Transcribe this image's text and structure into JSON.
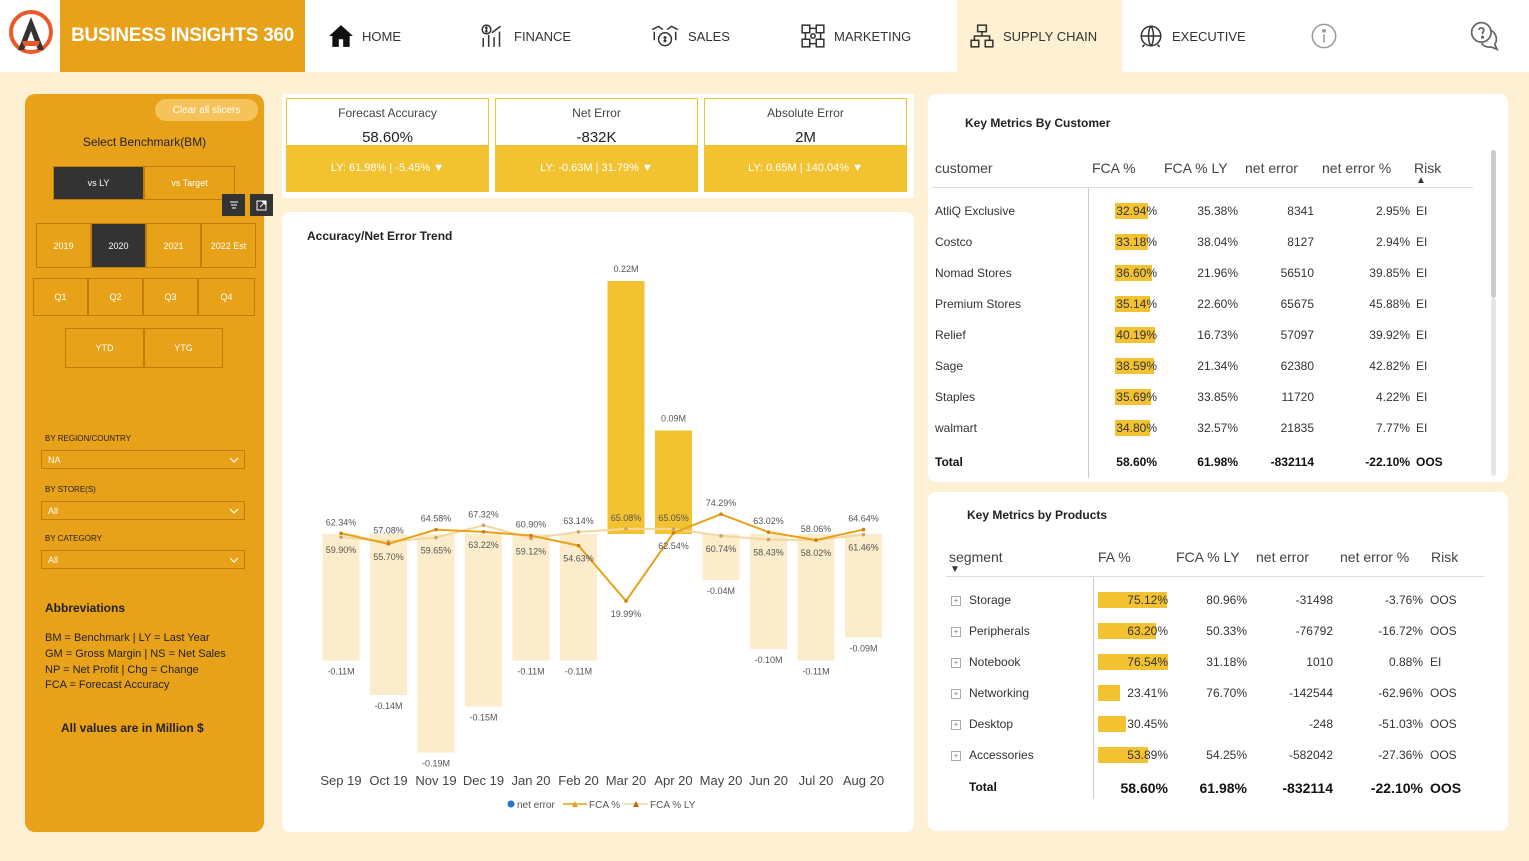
{
  "brand": {
    "title": "BUSINESS INSIGHTS 360"
  },
  "nav": [
    {
      "label": "HOME",
      "icon": "home-icon"
    },
    {
      "label": "FINANCE",
      "icon": "finance-icon"
    },
    {
      "label": "SALES",
      "icon": "sales-icon"
    },
    {
      "label": "MARKETING",
      "icon": "marketing-icon"
    },
    {
      "label": "SUPPLY CHAIN",
      "icon": "supply-chain-icon",
      "active": true
    },
    {
      "label": "EXECUTIVE",
      "icon": "executive-icon"
    }
  ],
  "sidebar": {
    "clear_label": "Clear all slicers",
    "benchmark_title": "Select Benchmark(BM)",
    "benchmark": [
      {
        "label": "vs LY",
        "selected": true
      },
      {
        "label": "vs Target",
        "selected": false
      }
    ],
    "years": [
      {
        "label": "2019"
      },
      {
        "label": "2020",
        "selected": true
      },
      {
        "label": "2021"
      },
      {
        "label": "2022 Est"
      }
    ],
    "quarters": [
      {
        "label": "Q1"
      },
      {
        "label": "Q2"
      },
      {
        "label": "Q3"
      },
      {
        "label": "Q4"
      }
    ],
    "periods": [
      {
        "label": "YTD"
      },
      {
        "label": "YTG"
      }
    ],
    "filters": [
      {
        "label": "BY REGION/COUNTRY",
        "value": "NA"
      },
      {
        "label": "BY STORE(S)",
        "value": "All"
      },
      {
        "label": "BY CATEGORY",
        "value": "All"
      }
    ],
    "abbreviations_title": "Abbreviations",
    "abbreviations": [
      "BM = Benchmark | LY = Last Year",
      "GM = Gross Margin | NS = Net Sales",
      "NP = Net Profit | Chg = Change",
      "FCA = Forecast Accuracy"
    ],
    "units_note": "All values are in Million $"
  },
  "kpis": [
    {
      "label": "Forecast Accuracy",
      "value": "58.60%",
      "ly": "LY: 61.98% | -5.45%"
    },
    {
      "label": "Net Error",
      "value": "-832K",
      "ly": "LY: -0.63M | 31.79%"
    },
    {
      "label": "Absolute Error",
      "value": "2M",
      "ly": "LY: 0.65M | 140.04%"
    }
  ],
  "colors": {
    "accent": "#e8a21a",
    "bar": "#f2c230",
    "bar_light": "#fbeccb",
    "fca_line": "#e8a21a",
    "fca_ly_line": "#f5d79e",
    "net_error_dot": "#1f78d1"
  },
  "chart": {
    "title": "Accuracy/Net Error Trend",
    "legend": [
      "net error",
      "FCA %",
      "FCA % LY"
    ]
  },
  "chart_data": {
    "type": "bar",
    "title": "Accuracy/Net Error Trend",
    "categories": [
      "Sep 19",
      "Oct 19",
      "Nov 19",
      "Dec 19",
      "Jan 20",
      "Feb 20",
      "Mar 20",
      "Apr 20",
      "May 20",
      "Jun 20",
      "Jul 20",
      "Aug 20"
    ],
    "series": [
      {
        "name": "net error",
        "type": "bar",
        "unit": "M",
        "values": [
          -0.11,
          -0.14,
          -0.19,
          -0.15,
          -0.11,
          -0.11,
          0.22,
          0.09,
          -0.04,
          -0.1,
          -0.11,
          -0.09
        ],
        "labels": [
          "-0.11M",
          "-0.14M",
          "-0.19M",
          "-0.15M",
          "-0.11M",
          "-0.11M",
          "0.22M",
          "0.09M",
          "-0.04M",
          "-0.10M",
          "-0.11M",
          "-0.09M"
        ]
      },
      {
        "name": "FCA %",
        "type": "line",
        "values": [
          62.34,
          55.7,
          64.58,
          63.22,
          60.9,
          54.63,
          19.99,
          62.54,
          74.29,
          63.02,
          58.06,
          64.64
        ],
        "labels": [
          "62.34%",
          "55.70%",
          "64.58%",
          "63.22%",
          "60.90%",
          "54.63%",
          "19.99%",
          "62.54%",
          "74.29%",
          "63.02%",
          "58.06%",
          "64.64%"
        ]
      },
      {
        "name": "FCA % LY",
        "type": "line",
        "values": [
          59.9,
          57.08,
          59.65,
          67.32,
          59.12,
          63.14,
          65.08,
          65.05,
          60.74,
          58.43,
          58.02,
          61.46
        ],
        "labels": [
          "59.90%",
          "57.08%",
          "59.65%",
          "67.32%",
          "59.12%",
          "63.14%",
          "65.08%",
          "65.05%",
          "60.74%",
          "58.43%",
          "58.02%",
          "61.46%"
        ]
      }
    ]
  },
  "customers": {
    "title": "Key Metrics By Customer",
    "columns": [
      "customer",
      "FCA %",
      "FCA % LY",
      "net error",
      "net error %",
      "Risk"
    ],
    "rows": [
      {
        "name": "AtliQ Exclusive",
        "fca": "32.94%",
        "fca_value": 32.94,
        "fca_ly": "35.38%",
        "net_error": "8341",
        "net_error_pct": "2.95%",
        "risk": "EI"
      },
      {
        "name": "Costco",
        "fca": "33.18%",
        "fca_value": 33.18,
        "fca_ly": "38.04%",
        "net_error": "8127",
        "net_error_pct": "2.94%",
        "risk": "EI"
      },
      {
        "name": "Nomad Stores",
        "fca": "36.60%",
        "fca_value": 36.6,
        "fca_ly": "21.96%",
        "net_error": "56510",
        "net_error_pct": "39.85%",
        "risk": "EI"
      },
      {
        "name": "Premium Stores",
        "fca": "35.14%",
        "fca_value": 35.14,
        "fca_ly": "22.60%",
        "net_error": "65675",
        "net_error_pct": "45.88%",
        "risk": "EI"
      },
      {
        "name": "Relief",
        "fca": "40.19%",
        "fca_value": 40.19,
        "fca_ly": "16.73%",
        "net_error": "57097",
        "net_error_pct": "39.92%",
        "risk": "EI"
      },
      {
        "name": "Sage",
        "fca": "38.59%",
        "fca_value": 38.59,
        "fca_ly": "21.34%",
        "net_error": "62380",
        "net_error_pct": "42.82%",
        "risk": "EI"
      },
      {
        "name": "Staples",
        "fca": "35.69%",
        "fca_value": 35.69,
        "fca_ly": "33.85%",
        "net_error": "11720",
        "net_error_pct": "4.22%",
        "risk": "EI"
      },
      {
        "name": "walmart",
        "fca": "34.80%",
        "fca_value": 34.8,
        "fca_ly": "32.57%",
        "net_error": "21835",
        "net_error_pct": "7.77%",
        "risk": "EI"
      }
    ],
    "total": {
      "name": "Total",
      "fca": "58.60%",
      "fca_ly": "61.98%",
      "net_error": "-832114",
      "net_error_pct": "-22.10%",
      "risk": "OOS"
    }
  },
  "products": {
    "title": "Key Metrics by Products",
    "columns": [
      "segment",
      "FA %",
      "FCA % LY",
      "net error",
      "net error %",
      "Risk"
    ],
    "rows": [
      {
        "name": "Storage",
        "fca": "75.12%",
        "fca_value": 75.12,
        "fca_ly": "80.96%",
        "net_error": "-31498",
        "net_error_pct": "-3.76%",
        "risk": "OOS"
      },
      {
        "name": "Peripherals",
        "fca": "63.20%",
        "fca_value": 63.2,
        "fca_ly": "50.33%",
        "net_error": "-76792",
        "net_error_pct": "-16.72%",
        "risk": "OOS"
      },
      {
        "name": "Notebook",
        "fca": "76.54%",
        "fca_value": 76.54,
        "fca_ly": "31.18%",
        "net_error": "1010",
        "net_error_pct": "0.88%",
        "risk": "EI"
      },
      {
        "name": "Networking",
        "fca": "23.41%",
        "fca_value": 23.41,
        "fca_ly": "76.70%",
        "net_error": "-142544",
        "net_error_pct": "-62.96%",
        "risk": "OOS"
      },
      {
        "name": "Desktop",
        "fca": "30.45%",
        "fca_value": 30.45,
        "fca_ly": "",
        "net_error": "-248",
        "net_error_pct": "-51.03%",
        "risk": "OOS"
      },
      {
        "name": "Accessories",
        "fca": "53.89%",
        "fca_value": 53.89,
        "fca_ly": "54.25%",
        "net_error": "-582042",
        "net_error_pct": "-27.36%",
        "risk": "OOS"
      }
    ],
    "total": {
      "name": "Total",
      "fca": "58.60%",
      "fca_ly": "61.98%",
      "net_error": "-832114",
      "net_error_pct": "-22.10%",
      "risk": "OOS"
    }
  }
}
